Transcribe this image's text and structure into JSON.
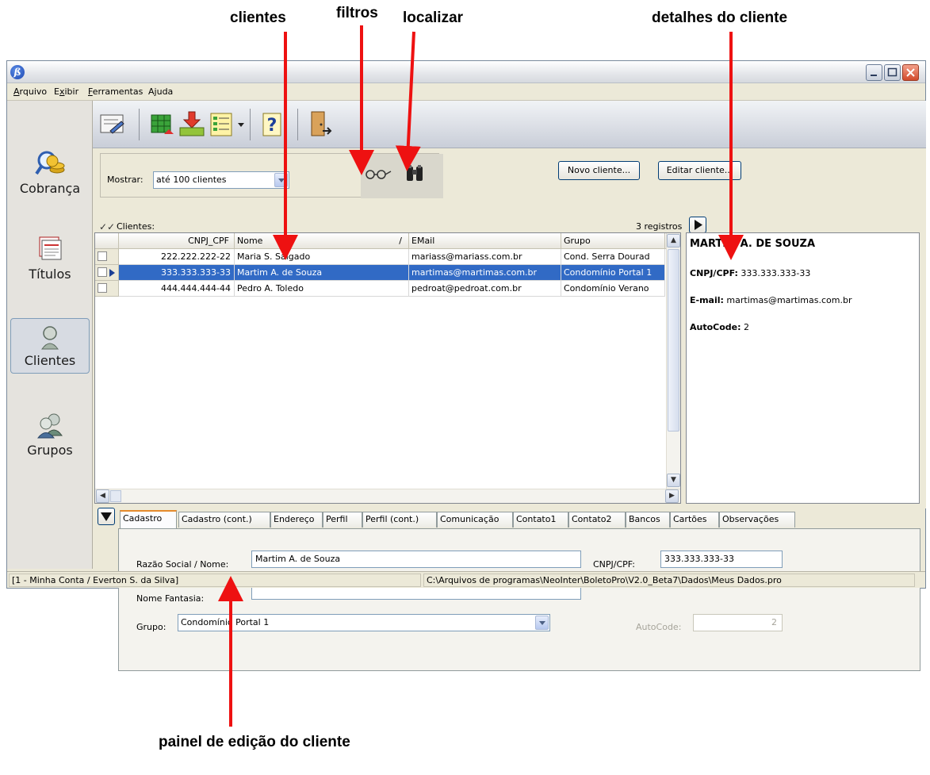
{
  "callouts": {
    "clientes": "clientes",
    "filtros": "filtros",
    "localizar": "localizar",
    "detalhes": "detalhes do cliente",
    "painel": "painel de edição do cliente"
  },
  "window": {
    "app_icon": "ß",
    "controls": [
      "minimize-icon",
      "maximize-icon",
      "close-icon"
    ]
  },
  "menu": {
    "arquivo": {
      "pre": "",
      "key": "A",
      "post": "rquivo"
    },
    "exibir": {
      "pre": "E",
      "key": "x",
      "post": "ibir"
    },
    "ferramentas": {
      "pre": "",
      "key": "F",
      "post": "erramentas"
    },
    "ajuda": {
      "pre": "A",
      "key": "j",
      "post": "uda"
    }
  },
  "sidebar": {
    "items": [
      {
        "label": "Cobrança",
        "icon": "magnifier-coins-icon"
      },
      {
        "label": "Títulos",
        "icon": "documents-icon"
      },
      {
        "label": "Clientes",
        "icon": "person-icon",
        "active": true
      },
      {
        "label": "Grupos",
        "icon": "group-icon"
      }
    ]
  },
  "toolbar": {
    "icons": [
      "form-edit-icon",
      "grid-export-icon",
      "download-icon",
      "list-view-icon",
      "help-icon",
      "exit-door-icon"
    ]
  },
  "filter": {
    "label": "Mostrar:",
    "value": "até 100 clientes",
    "filter_icon": "glasses-icon",
    "find_icon": "binoculars-icon"
  },
  "actions": {
    "novo": "Novo cliente...",
    "editar": "Editar cliente..."
  },
  "list": {
    "title": "Clientes:",
    "count": "3 registros",
    "columns": [
      "CNPJ_CPF",
      "Nome",
      "EMail",
      "Grupo"
    ],
    "sort_indicator": "/",
    "rows": [
      {
        "cnpj": "222.222.222-22",
        "nome": "Maria S. Salgado",
        "email": "mariass@mariass.com.br",
        "grupo": "Cond. Serra Dourad"
      },
      {
        "cnpj": "333.333.333-33",
        "nome": "Martim A. de Souza",
        "email": "martimas@martimas.com.br",
        "grupo": "Condomínio Portal 1",
        "selected": true
      },
      {
        "cnpj": "444.444.444-44",
        "nome": "Pedro A. Toledo",
        "email": "pedroat@pedroat.com.br",
        "grupo": "Condomínio Verano"
      }
    ]
  },
  "details": {
    "title": "MARTIM A. DE SOUZA",
    "cnpj_label": "CNPJ/CPF:",
    "cnpj": "333.333.333-33",
    "email_label": "E-mail:",
    "email": "martimas@martimas.com.br",
    "autocode_label": "AutoCode:",
    "autocode": "2"
  },
  "tabs": [
    "Cadastro",
    "Cadastro (cont.)",
    "Endereço",
    "Perfil",
    "Perfil (cont.)",
    "Comunicação",
    "Contato1",
    "Contato2",
    "Bancos",
    "Cartões",
    "Observações"
  ],
  "form": {
    "razao_label": "Razão Social / Nome:",
    "razao_value": "Martim A. de Souza",
    "fantasia_label": "Nome Fantasia:",
    "fantasia_value": "",
    "grupo_label": "Grupo:",
    "grupo_value": "Condomínio Portal 1",
    "cnpj_label": "CNPJ/CPF:",
    "cnpj_value": "333.333.333-33",
    "autocode_label": "AutoCode:",
    "autocode_value": "2"
  },
  "status": {
    "account": "[1 - Minha Conta / Everton S. da Silva]",
    "path": "C:\\Arquivos de programas\\NeoInter\\BoletoPro\\V2.0_Beta7\\Dados\\Meus Dados.pro"
  },
  "colors": {
    "selection": "#316ac5",
    "arrow": "#ee1111",
    "tab_highlight": "#e68b2c"
  }
}
